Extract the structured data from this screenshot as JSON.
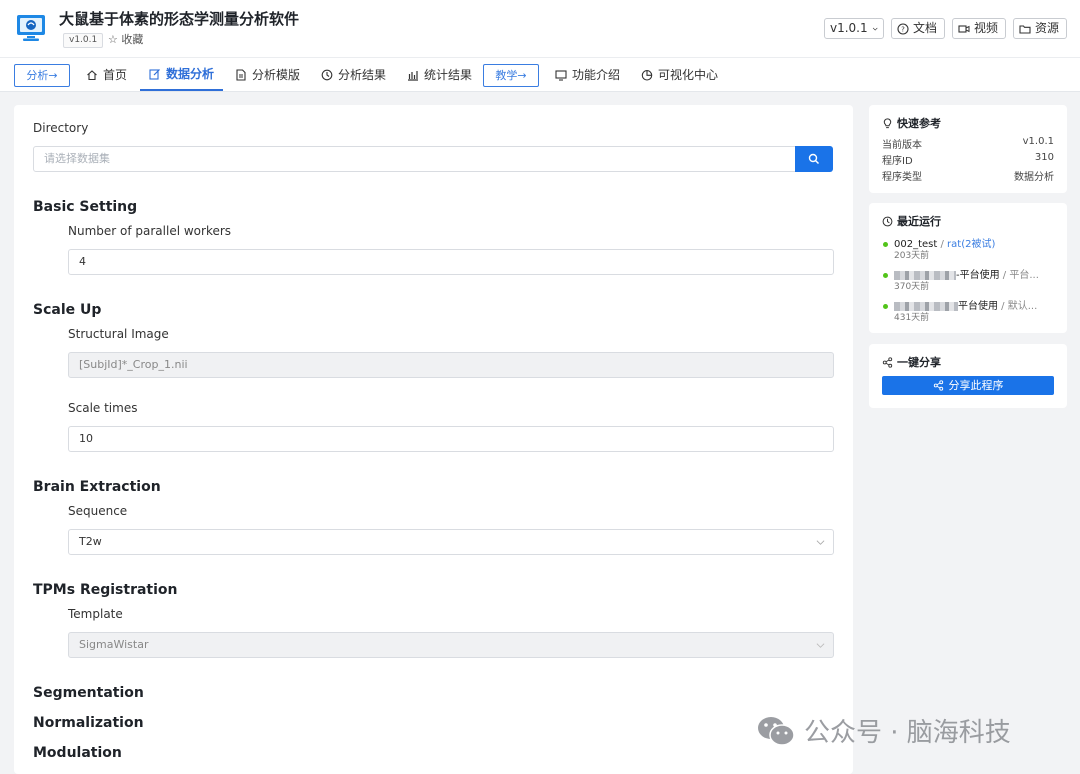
{
  "header": {
    "title": "大鼠基于体素的形态学测量分析软件",
    "version_tag": "v1.0.1",
    "favorite_label": "收藏",
    "version_select": "v1.0.1",
    "docs_label": "文档",
    "video_label": "视频",
    "resources_label": "资源"
  },
  "nav": {
    "analyze_btn": "分析→",
    "teach_btn": "教学→",
    "items": [
      "首页",
      "数据分析",
      "分析模版",
      "分析结果",
      "统计结果",
      "功能介绍",
      "可视化中心"
    ],
    "active": "数据分析"
  },
  "form": {
    "directory_label": "Directory",
    "directory_placeholder": "请选择数据集",
    "basic_setting": "Basic Setting",
    "workers_label": "Number of parallel workers",
    "workers_value": "4",
    "scale_up": "Scale Up",
    "structural_label": "Structural Image",
    "structural_value": "[SubjId]*_Crop_1.nii",
    "scale_times_label": "Scale times",
    "scale_times_value": "10",
    "brain_extraction": "Brain Extraction",
    "sequence_label": "Sequence",
    "sequence_value": "T2w",
    "tpms_registration": "TPMs Registration",
    "template_label": "Template",
    "template_value": "SigmaWistar",
    "segmentation": "Segmentation",
    "normalization": "Normalization",
    "modulation": "Modulation"
  },
  "quick_ref": {
    "title": "快速参考",
    "rows": [
      {
        "k": "当前版本",
        "v": "v1.0.1"
      },
      {
        "k": "程序ID",
        "v": "310"
      },
      {
        "k": "程序类型",
        "v": "数据分析"
      }
    ]
  },
  "recent_runs": {
    "title": "最近运行",
    "runs": [
      {
        "name": "002_test",
        "sep": " / ",
        "link": "rat(2被试)",
        "time": "203天前"
      },
      {
        "name": "-平台使用",
        "sep": " / ",
        "link": "平台...",
        "time": "370天前"
      },
      {
        "name": "平台使用",
        "sep": " / ",
        "link": "默认...",
        "time": "431天前"
      }
    ]
  },
  "share": {
    "title": "一键分享",
    "button": "分享此程序"
  },
  "watermark": {
    "text": "公众号 · 脑海科技"
  },
  "colors": {
    "primary": "#1a73e8",
    "status_ok": "#52c41a"
  }
}
